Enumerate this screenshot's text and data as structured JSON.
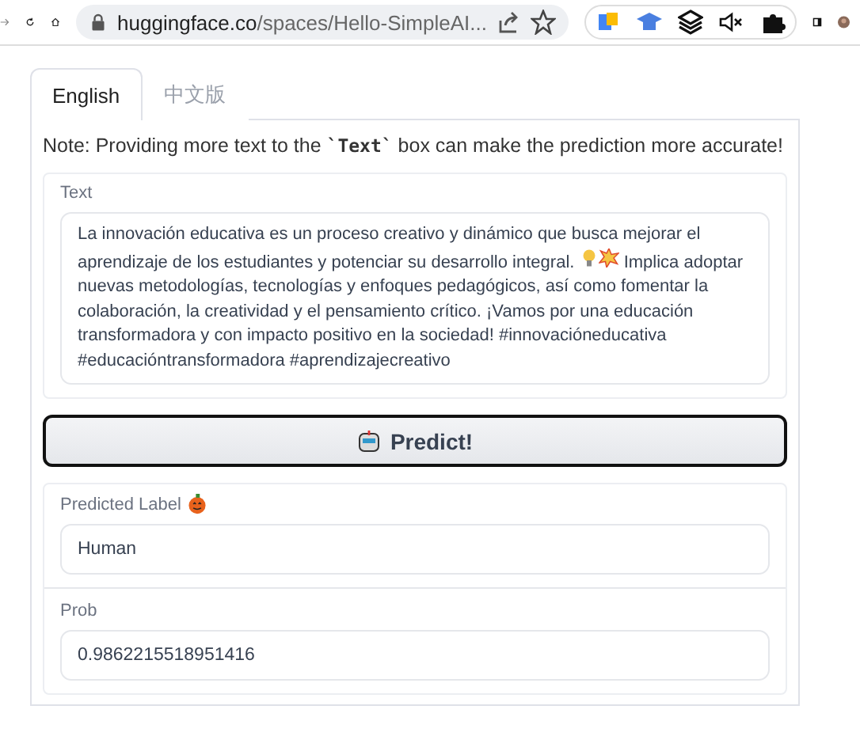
{
  "browser": {
    "url_host": "huggingface.co",
    "url_path": "/spaces/Hello-SimpleAI..."
  },
  "tabs": [
    {
      "label": "English",
      "selected": true
    },
    {
      "label": "中文版",
      "selected": false
    }
  ],
  "note": {
    "before": "Note: Providing more text to the ",
    "code": "`Text`",
    "after": " box can make the prediction more accurate!"
  },
  "input": {
    "label": "Text",
    "value_before": "La innovación educativa es un proceso creativo y dinámico que busca mejorar el aprendizaje de los estudiantes y potenciar su desarrollo integral.",
    "value_after": "Implica adoptar nuevas metodologías, tecnologías y enfoques pedagógicos, así como fomentar la colaboración, la creatividad y el pensamiento crítico. ¡Vamos por una educación transformadora y con impacto positivo en la sociedad! #innovacióneducativa #educacióntransformadora #aprendizajecreativo"
  },
  "predict_button": {
    "label": "Predict!"
  },
  "outputs": [
    {
      "label": "Predicted Label",
      "kind": "label",
      "value": "Human"
    },
    {
      "label": "Prob",
      "kind": "plain",
      "value": "0.9862215518951416"
    }
  ]
}
